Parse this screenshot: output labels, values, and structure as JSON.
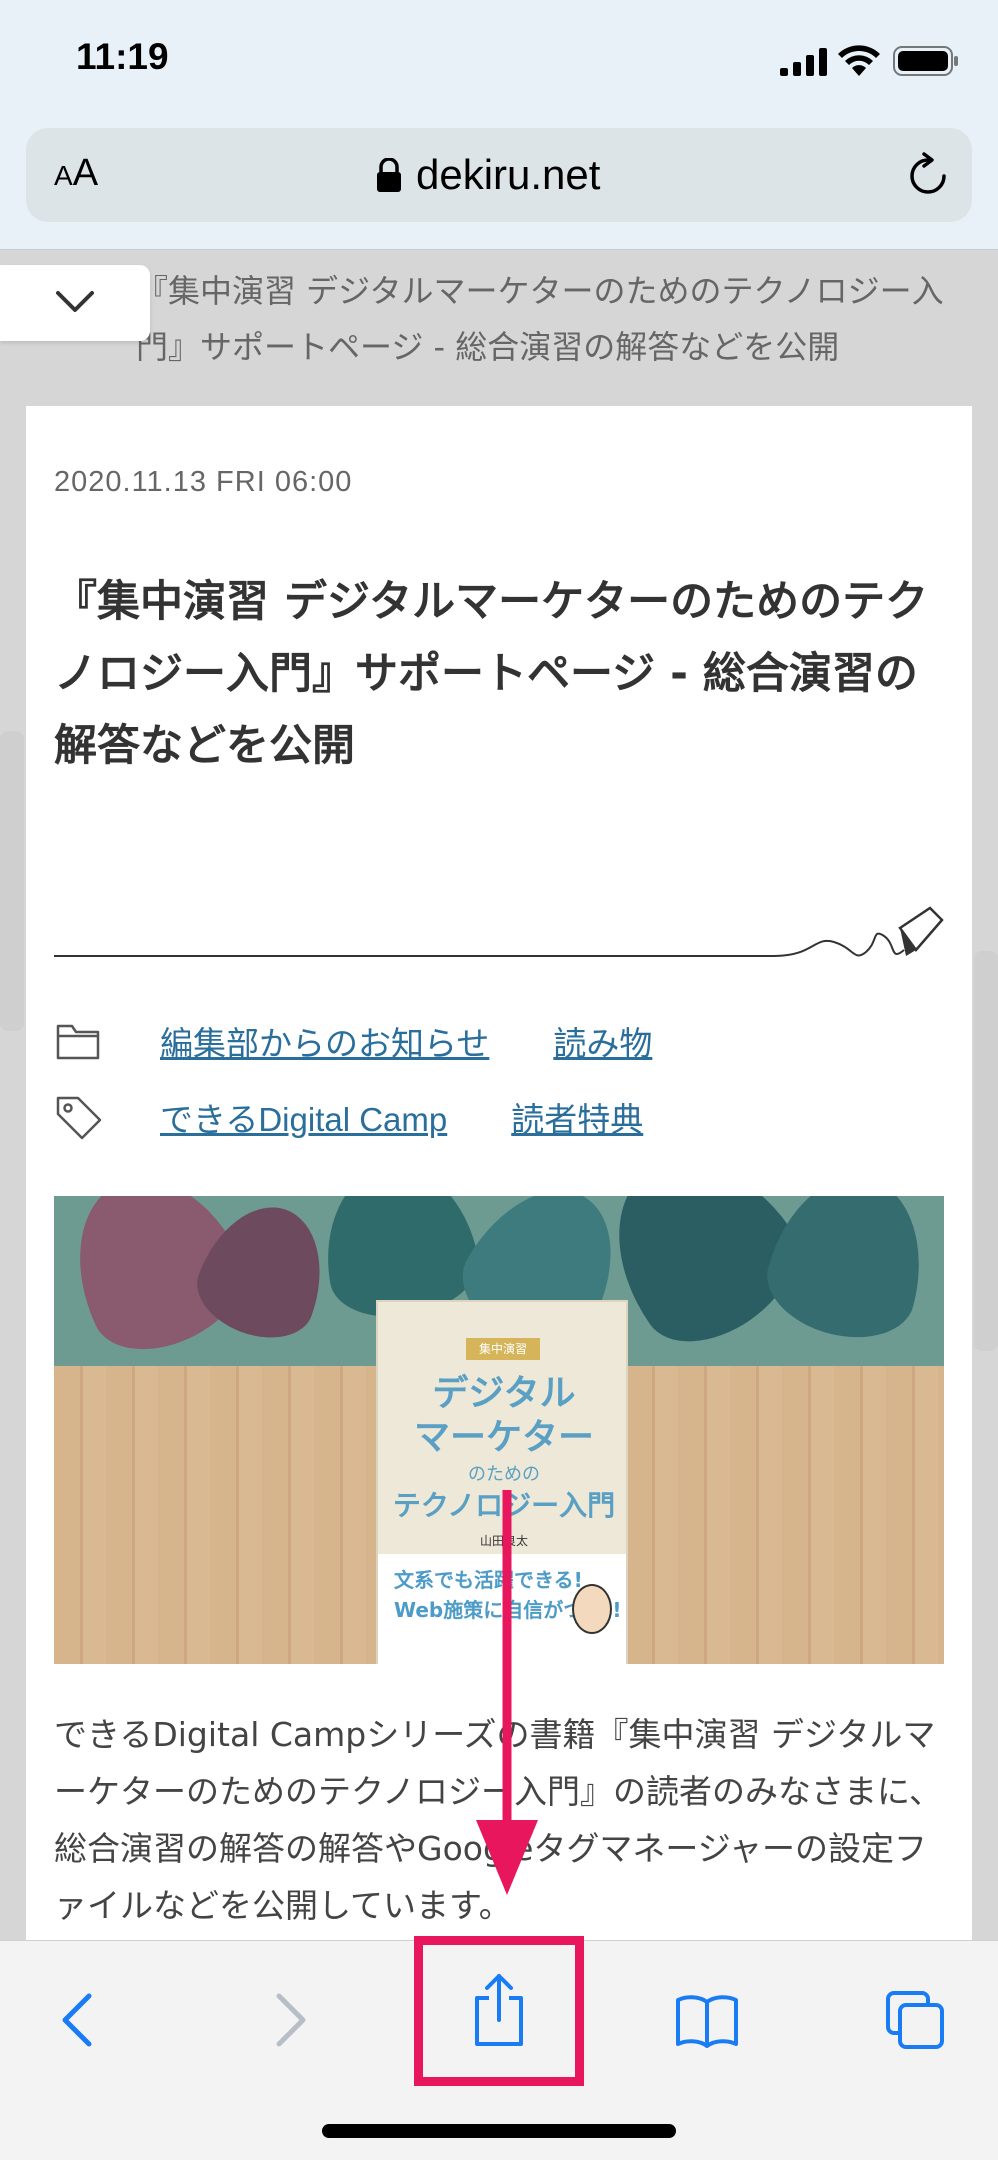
{
  "status_bar": {
    "time": "11:19",
    "icons": [
      "signal-icon",
      "wifi-icon",
      "battery-icon"
    ]
  },
  "address_bar": {
    "text_size_label_small": "A",
    "text_size_label_big": "A",
    "url": "dekiru.net",
    "icons": [
      "lock-icon",
      "reload-icon"
    ]
  },
  "collapsed_header": {
    "title": "『集中演習 デジタルマーケターのためのテクノロジー入門』サポートページ - 総合演習の解答などを公開"
  },
  "article": {
    "date": "2020.11.13 FRI 06:00",
    "title": "『集中演習 デジタルマーケターのためのテクノロジー入門』サポートページ - 総合演習の解答などを公開",
    "categories": [
      "編集部からのお知らせ",
      "読み物"
    ],
    "tags": [
      "できるDigital Camp",
      "読者特典"
    ],
    "body": "できるDigital Campシリーズの書籍『集中演習 デジタルマーケターのためのテクノロジー入門』の読者のみなさまに、総合演習の解答の解答やGoogleタグマネージャーの設定ファイルなどを公開しています。"
  },
  "book_cover": {
    "tag": "集中演習",
    "title_line1": "デジタル",
    "title_line2": "マーケター",
    "subtitle": "のための",
    "title_line3": "テクノロジー入門",
    "author": "山田良太",
    "band_line1": "文系でも活躍できる!",
    "band_line2": "Web施策に自信がつく!!"
  },
  "toolbar": {
    "buttons": [
      "back-icon",
      "forward-icon",
      "share-icon",
      "bookmarks-icon",
      "tabs-icon"
    ]
  },
  "colors": {
    "accent": "#e8175d",
    "link": "#2a6e9c",
    "ios_blue": "#1a7cf5"
  }
}
